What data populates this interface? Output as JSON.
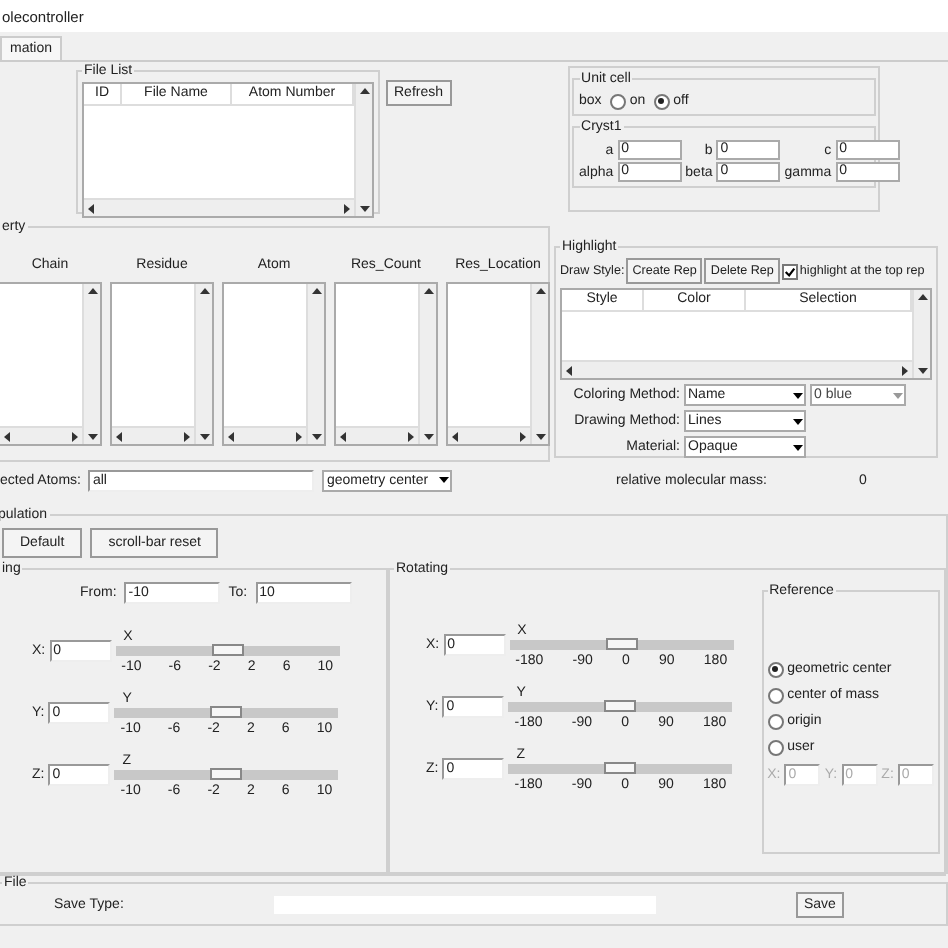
{
  "window": {
    "title": "olecontroller"
  },
  "tabs": [
    {
      "label": "mation",
      "selected": true
    }
  ],
  "file_list": {
    "title": "File List",
    "columns": [
      "ID",
      "File Name",
      "Atom Number"
    ]
  },
  "refresh_button": "Refresh",
  "unit_cell": {
    "title": "Unit cell",
    "box_label": "box",
    "options": [
      {
        "label": "on",
        "selected": false
      },
      {
        "label": "off",
        "selected": true
      }
    ]
  },
  "cryst1": {
    "title": "Cryst1",
    "fields": [
      {
        "label": "a",
        "value": "0"
      },
      {
        "label": "b",
        "value": "0"
      },
      {
        "label": "c",
        "value": "0"
      },
      {
        "label": "alpha",
        "value": "0"
      },
      {
        "label": "beta",
        "value": "0"
      },
      {
        "label": "gamma",
        "value": "0"
      }
    ]
  },
  "property": {
    "title": "erty",
    "lists": [
      {
        "heading": "Chain"
      },
      {
        "heading": "Residue"
      },
      {
        "heading": "Atom"
      },
      {
        "heading": "Res_Count"
      },
      {
        "heading": "Res_Location"
      }
    ]
  },
  "selected_atoms": {
    "label": "ected Atoms:",
    "value": "all",
    "mode": "geometry center"
  },
  "highlight": {
    "title": "Highlight",
    "draw_style_label": "Draw Style:",
    "buttons": [
      "Create Rep",
      "Delete Rep"
    ],
    "top_rep": {
      "label": "highlight at the top rep",
      "checked": true
    },
    "columns": [
      "Style",
      "Color",
      "Selection"
    ],
    "settings": [
      {
        "label": "Coloring Method:",
        "value": "Name",
        "extra": "0 blue"
      },
      {
        "label": "Drawing Method:",
        "value": "Lines"
      },
      {
        "label": "Material:",
        "value": "Opaque"
      }
    ]
  },
  "mass": {
    "label": "relative molecular mass:",
    "value": "0"
  },
  "manipulation": {
    "title": "pulation",
    "buttons": [
      "Default",
      "scroll-bar reset"
    ]
  },
  "moving": {
    "title": "ing",
    "from_label": "From:",
    "from": "-10",
    "to_label": "To:",
    "to": "10",
    "axes": [
      {
        "label": "X:",
        "value": "0",
        "slider_label": "X",
        "level": 0.5,
        "ticks": [
          "-10",
          "-6",
          "-2",
          "2",
          "6",
          "10"
        ]
      },
      {
        "label": "Y:",
        "value": "0",
        "slider_label": "Y",
        "level": 0.5,
        "ticks": [
          "-10",
          "-6",
          "-2",
          "2",
          "6",
          "10"
        ]
      },
      {
        "label": "Z:",
        "value": "0",
        "slider_label": "Z",
        "level": 0.5,
        "ticks": [
          "-10",
          "-6",
          "-2",
          "2",
          "6",
          "10"
        ]
      }
    ]
  },
  "rotating": {
    "title": "Rotating",
    "axes": [
      {
        "label": "X:",
        "value": "0",
        "slider_label": "X",
        "level": 0.5,
        "ticks": [
          "-180",
          "-90",
          "0",
          "90",
          "180"
        ]
      },
      {
        "label": "Y:",
        "value": "0",
        "slider_label": "Y",
        "level": 0.5,
        "ticks": [
          "-180",
          "-90",
          "0",
          "90",
          "180"
        ]
      },
      {
        "label": "Z:",
        "value": "0",
        "slider_label": "Z",
        "level": 0.5,
        "ticks": [
          "-180",
          "-90",
          "0",
          "90",
          "180"
        ]
      }
    ]
  },
  "reference": {
    "title": "Reference",
    "options": [
      {
        "label": "geometric center",
        "selected": true
      },
      {
        "label": "center of mass",
        "selected": false
      },
      {
        "label": "origin",
        "selected": false
      },
      {
        "label": "user",
        "selected": false
      }
    ],
    "user_fields": [
      {
        "label": "X:",
        "value": "0",
        "disabled": true
      },
      {
        "label": "Y:",
        "value": "0",
        "disabled": true
      },
      {
        "label": "Z:",
        "value": "0",
        "disabled": true
      }
    ]
  },
  "file": {
    "title": "File",
    "save_type_label": "Save Type:",
    "save_button": "Save"
  }
}
